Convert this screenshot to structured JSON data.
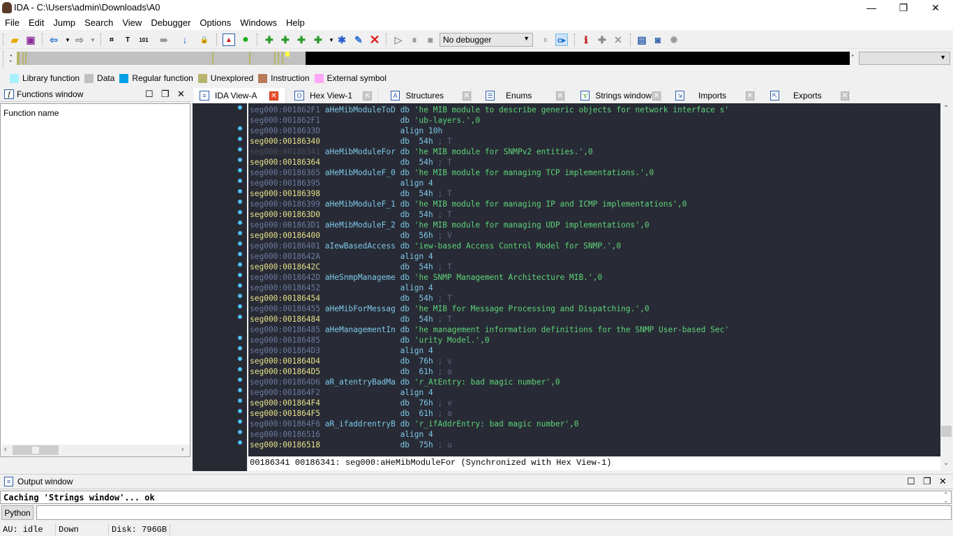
{
  "window": {
    "title": "IDA - C:\\Users\\admin\\Downloads\\A0",
    "minimize": "—",
    "restore": "❐",
    "close": "✕"
  },
  "menu": [
    "File",
    "Edit",
    "Jump",
    "Search",
    "View",
    "Debugger",
    "Options",
    "Windows",
    "Help"
  ],
  "toolbar": {
    "debugger_select": "No debugger",
    "icons": [
      "open-icon",
      "save-icon",
      "back-icon",
      "forward-icon",
      "search-sequence-icon",
      "search-text-icon",
      "search-binary-icon",
      "search-next-icon",
      "jump-icon",
      "lock-icon",
      "report-icon",
      "run-green-icon",
      "make-code-icon",
      "make-data-icon",
      "make-ascii-icon",
      "make-string-icon",
      "make-array-icon",
      "rename-icon",
      "undefine-icon",
      "start-debug-icon",
      "pause-icon",
      "stop-icon",
      "decompile-icon",
      "switch-view-icon",
      "breakpoint-info-icon",
      "add-breakpoint-icon",
      "remove-breakpoint-icon",
      "view-icon",
      "hex-view-icon",
      "debugger-bug-icon"
    ]
  },
  "legend": [
    {
      "label": "Library function",
      "color": "#a8f0ff"
    },
    {
      "label": "Data",
      "color": "#c0c0c0"
    },
    {
      "label": "Regular function",
      "color": "#00a0e8"
    },
    {
      "label": "Unexplored",
      "color": "#b8b470"
    },
    {
      "label": "Instruction",
      "color": "#b87a58"
    },
    {
      "label": "External symbol",
      "color": "#ffa8f8"
    }
  ],
  "functions_window": {
    "title": "Functions window",
    "column": "Function name"
  },
  "tabs": [
    {
      "label": "IDA View-A",
      "active": true
    },
    {
      "label": "Hex View-1"
    },
    {
      "label": "Structures"
    },
    {
      "label": "Enums"
    },
    {
      "label": "Strings window"
    },
    {
      "label": "Imports"
    },
    {
      "label": "Exports"
    }
  ],
  "listing": [
    {
      "addr": "seg000:001862F1",
      "type": "n",
      "label": "aHeMibModuleToD",
      "op": "db",
      "arg": "'he MIB module to describe generic objects for network interface s'",
      "cmt": ""
    },
    {
      "addr": "seg000:001862F1",
      "type": "n",
      "label": "",
      "op": "db",
      "arg": "'ub-layers.',0",
      "cmt": ""
    },
    {
      "addr": "seg000:0018633D",
      "type": "n",
      "label": "",
      "op": "align",
      "arg": "10h",
      "cmt": ""
    },
    {
      "addr": "seg000:00186340",
      "type": "h",
      "label": "",
      "op": "db",
      "arg": " 54h",
      "cmt": "; T"
    },
    {
      "addr": "seg000:00186341",
      "type": "d",
      "label": "aHeMibModuleFor",
      "op": "db",
      "arg": "'he MIB module for SNMPv2 entities.',0",
      "cmt": ""
    },
    {
      "addr": "seg000:00186364",
      "type": "h",
      "label": "",
      "op": "db",
      "arg": " 54h",
      "cmt": "; T"
    },
    {
      "addr": "seg000:00186365",
      "type": "n",
      "label": "aHeMibModuleF_0",
      "op": "db",
      "arg": "'he MIB module for managing TCP implementations.',0",
      "cmt": ""
    },
    {
      "addr": "seg000:00186395",
      "type": "n",
      "label": "",
      "op": "align",
      "arg": "4",
      "cmt": ""
    },
    {
      "addr": "seg000:00186398",
      "type": "h",
      "label": "",
      "op": "db",
      "arg": " 54h",
      "cmt": "; T"
    },
    {
      "addr": "seg000:00186399",
      "type": "n",
      "label": "aHeMibModuleF_1",
      "op": "db",
      "arg": "'he MIB module for managing IP and ICMP implementations',0",
      "cmt": ""
    },
    {
      "addr": "seg000:001863D0",
      "type": "h",
      "label": "",
      "op": "db",
      "arg": " 54h",
      "cmt": "; T"
    },
    {
      "addr": "seg000:001863D1",
      "type": "n",
      "label": "aHeMibModuleF_2",
      "op": "db",
      "arg": "'he MIB module for managing UDP implementations',0",
      "cmt": ""
    },
    {
      "addr": "seg000:00186400",
      "type": "h",
      "label": "",
      "op": "db",
      "arg": " 56h",
      "cmt": "; V"
    },
    {
      "addr": "seg000:00186401",
      "type": "n",
      "label": "aIewBasedAccess",
      "op": "db",
      "arg": "'iew-based Access Control Model for SNMP.',0",
      "cmt": ""
    },
    {
      "addr": "seg000:0018642A",
      "type": "n",
      "label": "",
      "op": "align",
      "arg": "4",
      "cmt": ""
    },
    {
      "addr": "seg000:0018642C",
      "type": "h",
      "label": "",
      "op": "db",
      "arg": " 54h",
      "cmt": "; T"
    },
    {
      "addr": "seg000:0018642D",
      "type": "n",
      "label": "aHeSnmpManageme",
      "op": "db",
      "arg": "'he SNMP Management Architecture MIB.',0",
      "cmt": ""
    },
    {
      "addr": "seg000:00186452",
      "type": "n",
      "label": "",
      "op": "align",
      "arg": "4",
      "cmt": ""
    },
    {
      "addr": "seg000:00186454",
      "type": "h",
      "label": "",
      "op": "db",
      "arg": " 54h",
      "cmt": "; T"
    },
    {
      "addr": "seg000:00186455",
      "type": "n",
      "label": "aHeMibForMessag",
      "op": "db",
      "arg": "'he MIB for Message Processing and Dispatching.',0",
      "cmt": ""
    },
    {
      "addr": "seg000:00186484",
      "type": "h",
      "label": "",
      "op": "db",
      "arg": " 54h",
      "cmt": "; T"
    },
    {
      "addr": "seg000:00186485",
      "type": "n",
      "label": "aHeManagementIn",
      "op": "db",
      "arg": "'he management information definitions for the SNMP User-based Sec'",
      "cmt": ""
    },
    {
      "addr": "seg000:00186485",
      "type": "n",
      "label": "",
      "op": "db",
      "arg": "'urity Model.',0",
      "cmt": ""
    },
    {
      "addr": "seg000:001864D3",
      "type": "n",
      "label": "",
      "op": "align",
      "arg": "4",
      "cmt": ""
    },
    {
      "addr": "seg000:001864D4",
      "type": "h",
      "label": "",
      "op": "db",
      "arg": " 76h",
      "cmt": "; v"
    },
    {
      "addr": "seg000:001864D5",
      "type": "h",
      "label": "",
      "op": "db",
      "arg": " 61h",
      "cmt": "; a"
    },
    {
      "addr": "seg000:001864D6",
      "type": "n",
      "label": "aR_atentryBadMa",
      "op": "db",
      "arg": "'r_AtEntry: bad magic number',0",
      "cmt": ""
    },
    {
      "addr": "seg000:001864F2",
      "type": "n",
      "label": "",
      "op": "align",
      "arg": "4",
      "cmt": ""
    },
    {
      "addr": "seg000:001864F4",
      "type": "h",
      "label": "",
      "op": "db",
      "arg": " 76h",
      "cmt": "; v"
    },
    {
      "addr": "seg000:001864F5",
      "type": "h",
      "label": "",
      "op": "db",
      "arg": " 61h",
      "cmt": "; a"
    },
    {
      "addr": "seg000:001864F6",
      "type": "n",
      "label": "aR_ifaddrentryB",
      "op": "db",
      "arg": "'r_ifAddrEntry: bad magic number',0",
      "cmt": ""
    },
    {
      "addr": "seg000:00186516",
      "type": "n",
      "label": "",
      "op": "align",
      "arg": "4",
      "cmt": ""
    },
    {
      "addr": "seg000:00186518",
      "type": "h",
      "label": "",
      "op": "db",
      "arg": " 75h",
      "cmt": "; u"
    }
  ],
  "listing_status": "00186341 00186341: seg000:aHeMibModuleFor (Synchronized with Hex View-1)",
  "output_window": {
    "title": "Output window",
    "text": "Caching 'Strings window'... ok",
    "python_button": "Python",
    "input_value": ""
  },
  "statusbar": {
    "au": "AU:  idle",
    "direction": "Down",
    "disk": "Disk: 796GB"
  }
}
